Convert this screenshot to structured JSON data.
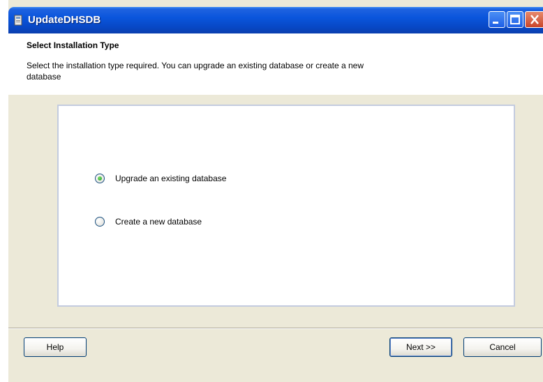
{
  "window": {
    "title": "UpdateDHSDB"
  },
  "header": {
    "title": "Select Installation Type",
    "description": "Select the installation type required. You can upgrade an existing database or create a new database"
  },
  "options": [
    {
      "label": "Upgrade an existing database",
      "selected": true
    },
    {
      "label": "Create a new database",
      "selected": false
    }
  ],
  "buttons": {
    "help": "Help",
    "next": "Next >>",
    "cancel": "Cancel"
  },
  "colors": {
    "titlebar": "#0a55dc",
    "dialog_bg": "#ece9d8",
    "radio_selected": "#21a121"
  },
  "icons": [
    "app-icon",
    "minimize-icon",
    "maximize-icon",
    "close-icon"
  ]
}
